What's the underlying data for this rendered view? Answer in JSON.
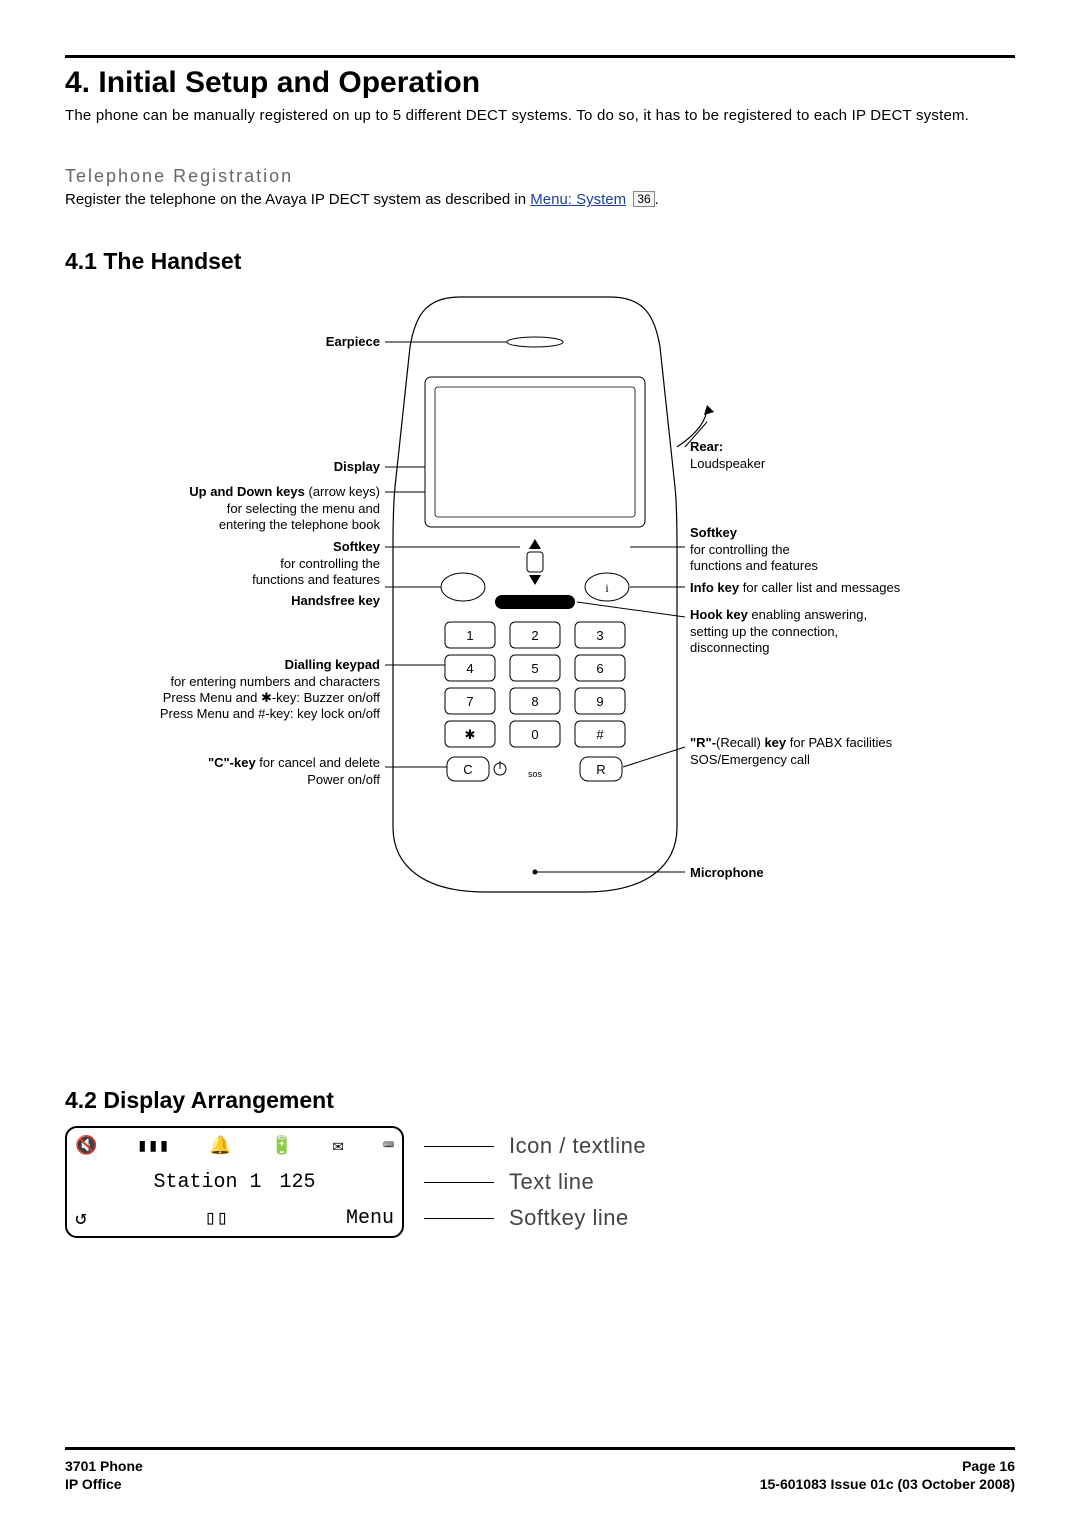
{
  "title": "4. Initial Setup and Operation",
  "intro": "The phone can be manually registered on up to 5 different DECT systems. To do so, it has to be registered to each IP DECT system.",
  "tele_reg_heading": "Telephone Registration",
  "tele_reg_text_1": "Register the telephone on the Avaya IP DECT system as described in ",
  "tele_reg_link": "Menu: System",
  "tele_reg_page": "36",
  "h2_handset": "4.1 The Handset",
  "h2_display": "4.2 Display Arrangement",
  "handset_labels": {
    "earpiece": "Earpiece",
    "display": "Display",
    "updown_b": "Up and Down keys",
    "updown_rest": " (arrow keys)\nfor selecting the menu and\nentering the telephone book",
    "softkey_l_b": "Softkey",
    "softkey_l_rest": "for controlling the\nfunctions and features",
    "handsfree": "Handsfree key",
    "dial_b": "Dialling keypad",
    "dial_rest": "for entering numbers and characters\nPress Menu and ✱-key: Buzzer on/off\nPress Menu and #-key: key lock on/off",
    "menu_u": "Menu",
    "ckey_b": "\"C\"-key",
    "ckey_rest": " for cancel and delete\nPower on/off",
    "rear_b": "Rear:",
    "rear_rest": "Loudspeaker",
    "softkey_r_b": "Softkey",
    "softkey_r_rest": "for controlling the\nfunctions and features",
    "info_b": "Info key",
    "info_rest": " for caller list and messages",
    "hook_b": "Hook key",
    "hook_rest": " enabling answering,\nsetting up the connection,\ndisconnecting",
    "rkey_b": "\"R\"-",
    "rkey_mid": "(Recall) ",
    "rkey_b2": "key",
    "rkey_rest": " for PABX facilities\nSOS/Emergency call",
    "mic": "Microphone"
  },
  "display": {
    "text_station": "Station 1",
    "text_num": "125",
    "soft_menu": "Menu",
    "label_icon": "Icon / textline",
    "label_text": "Text line",
    "label_soft": "Softkey line"
  },
  "footer": {
    "left1": "3701 Phone",
    "left2": "IP Office",
    "right1": "Page 16",
    "right2": "15-601083 Issue 01c (03 October 2008)"
  }
}
